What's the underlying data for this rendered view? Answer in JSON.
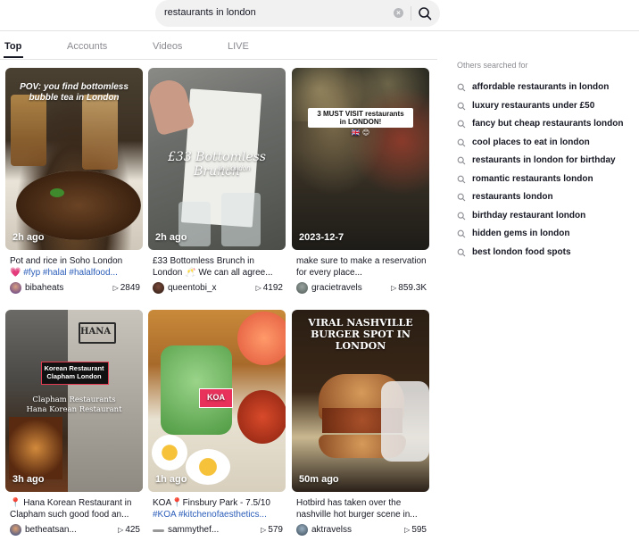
{
  "search": {
    "query": "restaurants in london",
    "clear_label": "×"
  },
  "tabs": [
    {
      "label": "Top"
    },
    {
      "label": "Accounts"
    },
    {
      "label": "Videos"
    },
    {
      "label": "LIVE"
    }
  ],
  "videos": [
    {
      "overlay": "POV: you find bottomless bubble tea in London",
      "date": "2h ago",
      "caption_text": "Pot and rice in Soho London",
      "caption_line2_prefix": "💗 ",
      "caption_tags": "#fyp #halal #halalfood...",
      "author": "bibaheats",
      "views": "2849"
    },
    {
      "overlay": "£33 Bottomless Brunch",
      "overlay_sub": "in London",
      "date": "2h ago",
      "caption_text": "£33 Bottomless Brunch in London 🥂 We can all agree...",
      "author": "queentobi_x",
      "views": "4192"
    },
    {
      "overlay": "3 MUST VISIT restaurants in LONDON!",
      "overlay_emoji": "🇬🇧 😊",
      "date": "2023-12-7",
      "caption_text": "make sure to make a reservation for every place...",
      "author": "gracietravels",
      "views": "859.3K"
    },
    {
      "overlay": "Korean Restaurant Clapham London",
      "overlay_sub": "Clapham Restaurants Hana Korean Restaurant",
      "sign": "HANA",
      "date": "3h ago",
      "caption_text": "📍 Hana Korean Restaurant in Clapham such good food an...",
      "author": "betheatsan...",
      "views": "425"
    },
    {
      "overlay": "KOA",
      "date": "1h ago",
      "caption_text": "KOA📍Finsbury Park - 7.5/10",
      "caption_tags": "#KOA #kitchenofaesthetics...",
      "author": "sammythef...",
      "views": "579"
    },
    {
      "overlay": "VIRAL NASHVILLE BURGER SPOT IN LONDON",
      "date": "50m ago",
      "caption_text": "Hotbird has taken over the nashville hot burger scene in...",
      "author": "aktravelss",
      "views": "595"
    }
  ],
  "sidebar": {
    "heading": "Others searched for",
    "items": [
      "affordable restaurants in london",
      "luxury restaurants under £50",
      "fancy but cheap restaurants london",
      "cool places to eat in london",
      "restaurants in london for birthday",
      "romantic restaurants london",
      "restaurants london",
      "birthday restaurant london",
      "hidden gems in london",
      "best london food spots"
    ]
  },
  "colors": {
    "accent_text": "#161823",
    "muted": "#8a8b91",
    "hashtag": "#2b5db9",
    "koa_pink": "#e8315b"
  },
  "icons": {
    "search": "search-icon",
    "clear": "clear-icon",
    "play": "play-icon"
  }
}
